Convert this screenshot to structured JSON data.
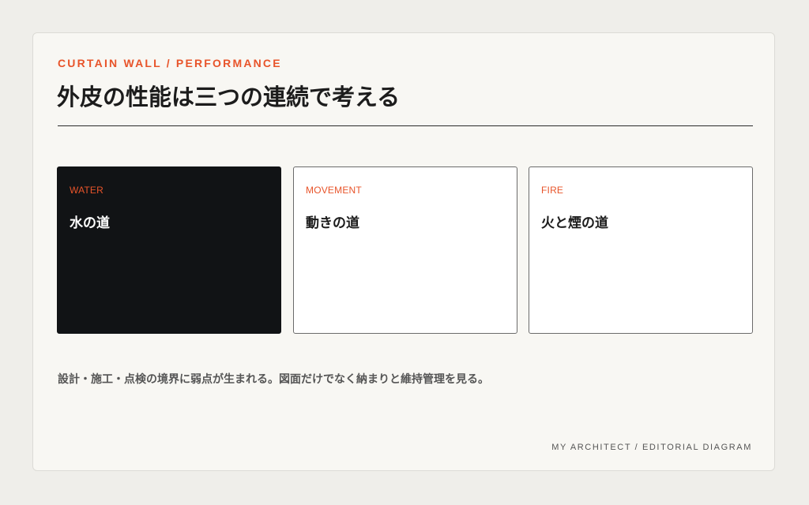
{
  "header": {
    "eyebrow": "CURTAIN WALL / PERFORMANCE",
    "title": "外皮の性能は三つの連続で考える"
  },
  "cards": [
    {
      "label": "WATER",
      "heading": "水の道",
      "style": "dark"
    },
    {
      "label": "MOVEMENT",
      "heading": "動きの道",
      "style": "light"
    },
    {
      "label": "FIRE",
      "heading": "火と煙の道",
      "style": "light"
    }
  ],
  "note": "設計・施工・点検の境界に弱点が生まれる。図面だけでなく納まりと維持管理を見る。",
  "footer": "MY ARCHITECT / EDITORIAL DIAGRAM",
  "colors": {
    "accent": "#e8542a",
    "dark_card": "#111315",
    "background": "#efeeea",
    "panel": "#f8f7f3"
  }
}
